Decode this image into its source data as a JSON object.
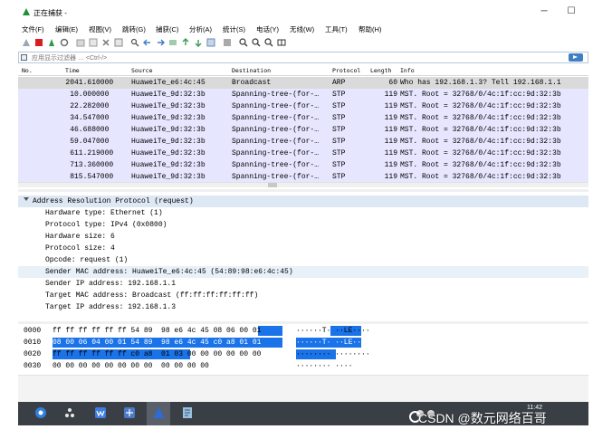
{
  "window": {
    "title": "正在捕获 -",
    "minimize_glyph": "─",
    "maximize_glyph": "☐"
  },
  "menu": [
    "文件(F)",
    "编辑(E)",
    "视图(V)",
    "跳转(G)",
    "捕获(C)",
    "分析(A)",
    "统计(S)",
    "电话(Y)",
    "无线(W)",
    "工具(T)",
    "帮助(H)"
  ],
  "toolbar_icons": [
    "shark-fin-icon",
    "stop-icon",
    "restart-icon",
    "options-gear-icon",
    "open-file-icon",
    "save-file-icon",
    "close-file-icon",
    "reload-icon",
    "find-icon",
    "back-icon",
    "forward-icon",
    "go-to-packet-icon",
    "first-packet-icon",
    "last-packet-icon",
    "autoscroll-icon",
    "colorize-icon",
    "zoom-in-icon",
    "zoom-out-icon",
    "zoom-normal-icon",
    "resize-columns-icon"
  ],
  "filter": {
    "placeholder": "应用显示过滤器 … <Ctrl-/>"
  },
  "packet_list": {
    "columns": [
      "No.",
      "Time",
      "Source",
      "Destination",
      "Protocol",
      "Length",
      "Info"
    ],
    "rows": [
      {
        "no": "20",
        "time": "41.610000",
        "src": "HuaweiTe_e6:4c:45",
        "dst": "Broadcast",
        "proto": "ARP",
        "len": "60",
        "info": "Who has 192.168.1.3? Tell 192.168.1.1",
        "selected": true
      },
      {
        "no": "1",
        "time": "0.000000",
        "src": "HuaweiTe_9d:32:3b",
        "dst": "Spanning-tree-(for-…",
        "proto": "STP",
        "len": "119",
        "info": "MST. Root = 32768/0/4c:1f:cc:9d:32:3b",
        "selected": false
      },
      {
        "no": "2",
        "time": "2.282000",
        "src": "HuaweiTe_9d:32:3b",
        "dst": "Spanning-tree-(for-…",
        "proto": "STP",
        "len": "119",
        "info": "MST. Root = 32768/0/4c:1f:cc:9d:32:3b",
        "selected": false
      },
      {
        "no": "3",
        "time": "4.547000",
        "src": "HuaweiTe_9d:32:3b",
        "dst": "Spanning-tree-(for-…",
        "proto": "STP",
        "len": "119",
        "info": "MST. Root = 32768/0/4c:1f:cc:9d:32:3b",
        "selected": false
      },
      {
        "no": "4",
        "time": "6.688000",
        "src": "HuaweiTe_9d:32:3b",
        "dst": "Spanning-tree-(for-…",
        "proto": "STP",
        "len": "119",
        "info": "MST. Root = 32768/0/4c:1f:cc:9d:32:3b",
        "selected": false
      },
      {
        "no": "5",
        "time": "9.047000",
        "src": "HuaweiTe_9d:32:3b",
        "dst": "Spanning-tree-(for-…",
        "proto": "STP",
        "len": "119",
        "info": "MST. Root = 32768/0/4c:1f:cc:9d:32:3b",
        "selected": false
      },
      {
        "no": "6",
        "time": "11.219000",
        "src": "HuaweiTe_9d:32:3b",
        "dst": "Spanning-tree-(for-…",
        "proto": "STP",
        "len": "119",
        "info": "MST. Root = 32768/0/4c:1f:cc:9d:32:3b",
        "selected": false
      },
      {
        "no": "7",
        "time": "13.360000",
        "src": "HuaweiTe_9d:32:3b",
        "dst": "Spanning-tree-(for-…",
        "proto": "STP",
        "len": "119",
        "info": "MST. Root = 32768/0/4c:1f:cc:9d:32:3b",
        "selected": false
      },
      {
        "no": "8",
        "time": "15.547000",
        "src": "HuaweiTe_9d:32:3b",
        "dst": "Spanning-tree-(for-…",
        "proto": "STP",
        "len": "119",
        "info": "MST. Root = 32768/0/4c:1f:cc:9d:32:3b",
        "selected": false
      }
    ]
  },
  "details": {
    "header": "Address Resolution Protocol (request)",
    "fields": [
      "Hardware type: Ethernet (1)",
      "Protocol type: IPv4 (0x0800)",
      "Hardware size: 6",
      "Protocol size: 4",
      "Opcode: request (1)",
      "Sender MAC address: HuaweiTe_e6:4c:45 (54:89:98:e6:4c:45)",
      "Sender IP address: 192.168.1.1",
      "Target MAC address: Broadcast (ff:ff:ff:ff:ff:ff)",
      "Target IP address: 192.168.1.3"
    ],
    "highlighted_field": 5
  },
  "hex_dump": {
    "rows": [
      {
        "offset": "0000",
        "bytes": "ff ff ff ff ff ff 54 89  98 e6 4c 45 08 06 00 01",
        "ascii": "······T· ··LE····"
      },
      {
        "offset": "0010",
        "bytes": "08 00 06 04 00 01 54 89  98 e6 4c 45 c0 a8 01 01",
        "ascii": "······T· ··LE····"
      },
      {
        "offset": "0020",
        "bytes": "ff ff ff ff ff ff c0 a8  01 03 00 00 00 00 00 00",
        "ascii": "········ ········"
      },
      {
        "offset": "0030",
        "bytes": "00 00 00 00 00 00 00 00  00 00 00 00",
        "ascii": "········ ····"
      }
    ]
  },
  "taskbar": {
    "clock": "11:42",
    "apps": [
      "start-icon",
      "settings-app-icon",
      "wps-icon",
      "ensp-icon",
      "wireshark-icon",
      "notepad-icon"
    ]
  },
  "watermark": {
    "text": "CSDN @数元网络百哥"
  },
  "colors": {
    "packet_row_bg": "#e7e6ff",
    "selected_row_bg": "#dadada",
    "hex_highlight": "#1a73e8",
    "taskbar_bg": "#3a3f46",
    "filter_apply": "#3f7fc4"
  }
}
